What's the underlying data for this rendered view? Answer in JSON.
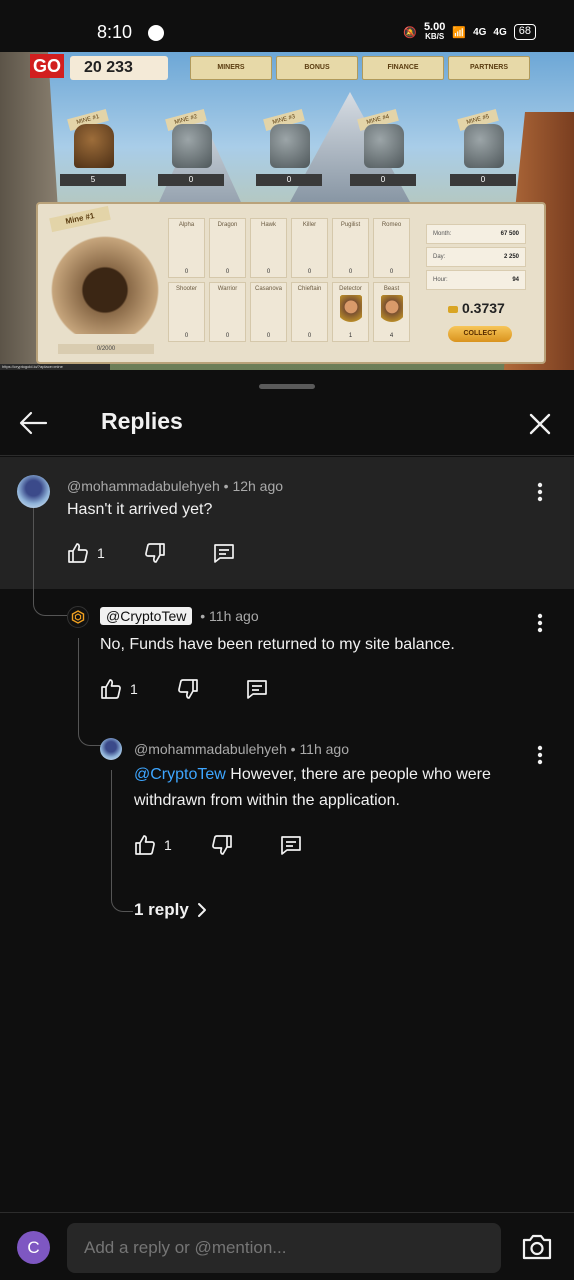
{
  "status_bar": {
    "time": "8:10",
    "net_speed": "5.00",
    "net_unit": "KB/S",
    "signal1": "4G",
    "signal2": "4G",
    "battery": "68"
  },
  "video": {
    "logo": "GO",
    "balance": "20 233",
    "nav": [
      "MINERS",
      "BONUS",
      "FINANCE",
      "PARTNERS"
    ],
    "mines": [
      {
        "label": "MINE #1",
        "count": "5",
        "locked": false
      },
      {
        "label": "MINE #2",
        "count": "0",
        "locked": true
      },
      {
        "label": "MINE #3",
        "count": "0",
        "locked": true
      },
      {
        "label": "MINE #4",
        "count": "0",
        "locked": true
      },
      {
        "label": "MINE #5",
        "count": "0",
        "locked": true
      }
    ],
    "panel": {
      "mine_label": "Mine #1",
      "progress": "0/2000",
      "workers": [
        {
          "name": "Alpha",
          "count": "0"
        },
        {
          "name": "Dragon",
          "count": "0"
        },
        {
          "name": "Hawk",
          "count": "0"
        },
        {
          "name": "Killer",
          "count": "0"
        },
        {
          "name": "Pugilist",
          "count": "0"
        },
        {
          "name": "Romeo",
          "count": "0"
        },
        {
          "name": "Shooter",
          "count": "0"
        },
        {
          "name": "Warrior",
          "count": "0"
        },
        {
          "name": "Casanova",
          "count": "0"
        },
        {
          "name": "Chieftain",
          "count": "0"
        },
        {
          "name": "Detector",
          "count": "1"
        },
        {
          "name": "Beast",
          "count": "4"
        }
      ],
      "stats": [
        {
          "label": "Month:",
          "value": "67 500"
        },
        {
          "label": "Day:",
          "value": "2 250"
        },
        {
          "label": "Hour:",
          "value": "94"
        }
      ],
      "total": "0.3737",
      "collect": "COLLECT"
    },
    "url": "https://cryptogold.io/?aplace=mine"
  },
  "replies": {
    "title": "Replies",
    "parent": {
      "author": "@mohammadabulehyeh",
      "age": "12h ago",
      "text": "Hasn't it arrived yet?",
      "likes": "1"
    },
    "reply1": {
      "author": "@CryptoTew",
      "age": "11h ago",
      "text": "No, Funds have been returned to my site balance.",
      "likes": "1"
    },
    "reply2": {
      "author": "@mohammadabulehyeh",
      "age": "11h ago",
      "mention": "@CryptoTew",
      "text": "However, there are people who were withdrawn from within the application.",
      "likes": "1"
    },
    "more_replies": "1 reply",
    "separator": "•"
  },
  "composer": {
    "avatar_letter": "C",
    "placeholder": "Add a reply or @mention..."
  },
  "colors": {
    "background": "#0f0f0f",
    "highlight_row": "#232323",
    "mention": "#3ea6ff",
    "avatar_purple": "#7e57c2"
  }
}
